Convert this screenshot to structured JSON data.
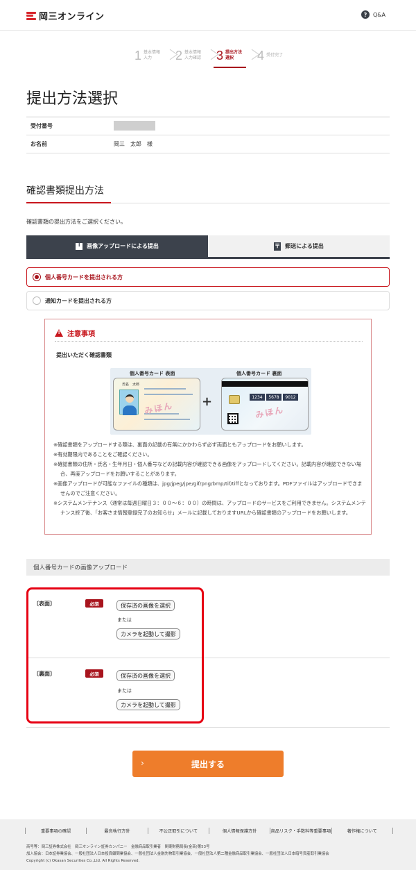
{
  "header": {
    "logo_text": "岡三オンライン",
    "help_icon_glyph": "?",
    "help_label": "Q&A"
  },
  "stepper": [
    {
      "num": "1",
      "label": "基本情報入力",
      "state": "done"
    },
    {
      "num": "2",
      "label": "基本情報入力確認",
      "state": "done"
    },
    {
      "num": "3",
      "label": "提出方法選択",
      "state": "active"
    },
    {
      "num": "4",
      "label": "受付完了",
      "state": "todo"
    }
  ],
  "page": {
    "title": "提出方法選択"
  },
  "info": {
    "receipt_label": "受付番号",
    "name_label": "お名前",
    "name_value": "岡三　太郎　様"
  },
  "section": {
    "title": "確認書類提出方法",
    "intro": "確認書類の提出方法をご選択ください。"
  },
  "tabs": {
    "upload": "画像アップロードによる提出",
    "post": "郵送による提出",
    "post_icon_glyph": "〒"
  },
  "options": [
    {
      "label": "個人番号カードを提出される方",
      "selected": true
    },
    {
      "label": "通知カードを提出される方",
      "selected": false
    }
  ],
  "notice": {
    "title": "注意事項",
    "subtitle": "提出いただく確認書類",
    "card_front_label": "個人番号カード 表面",
    "card_back_label": "個人番号カード 裏面",
    "card_front_name": "氏名　太郎",
    "mihon": "みほん",
    "plus": "+",
    "card_numbers": [
      "1234",
      "5678",
      "9012"
    ],
    "notes": [
      "※確認書類をアップロードする際は、裏面の記載の有無にかかわらず必ず両面ともアップロードをお願いします。",
      "※有効期限内であることをご確認ください。",
      "※確認書類の住所・氏名・生年月日・個人番号などの記載内容が確認できる画像をアップロードしてください。記載内容が確認できない場合、再度アップロードをお願いすることがあります。",
      "※画像アップロードが可能なファイルの種類は、jpg/jpeg/jpe/gif/png/bmp/tif/tiffとなっております。PDFファイルはアップロードできませんのでご注意ください。",
      "※システムメンテナンス（通常は毎週日曜日３：００～６：００）の時間は、アップロードのサービスをご利用できません。システムメンテナンス終了後、「お客さま情報登録完了のお知らせ」メールに記載しておりますURLから確認書類のアップロードをお願いします。"
    ]
  },
  "upload": {
    "heading": "個人番号カードの画像アップロード",
    "required": "必須",
    "select_saved": "保存済の画像を選択",
    "or": "または",
    "camera": "カメラを起動して撮影",
    "front_label": "〔表面〕",
    "back_label": "〔裏面〕"
  },
  "submit": {
    "label": "提出する",
    "chevron": "›"
  },
  "footer": {
    "links": [
      "重要事項の確認",
      "最良執行方針",
      "不公正取引について",
      "個人情報保護方針",
      "商品リスク・手数料等重要事項",
      "著作権について"
    ],
    "line1": "商号等：岡三証券株式会社　岡三オンライン証券カンパニー　金融商品取引業者　関東財務局長(金商)第53号",
    "line2": "加入協会：日本証券業協会、一般社団法人日本投資顧問業協会、一般社団法人金融先物取引業協会、一般社団法人第二種金融商品取引業協会、一般社団法人日本暗号資産取引業協会",
    "copyright": "Copyright (c) Okasan Securities Co.,Ltd. All Rights Reserved."
  },
  "colors": {
    "brand_red": "#c8161d",
    "dark_tab": "#3c424c",
    "submit_orange": "#ee7d2b",
    "highlight_red": "#e60012"
  }
}
